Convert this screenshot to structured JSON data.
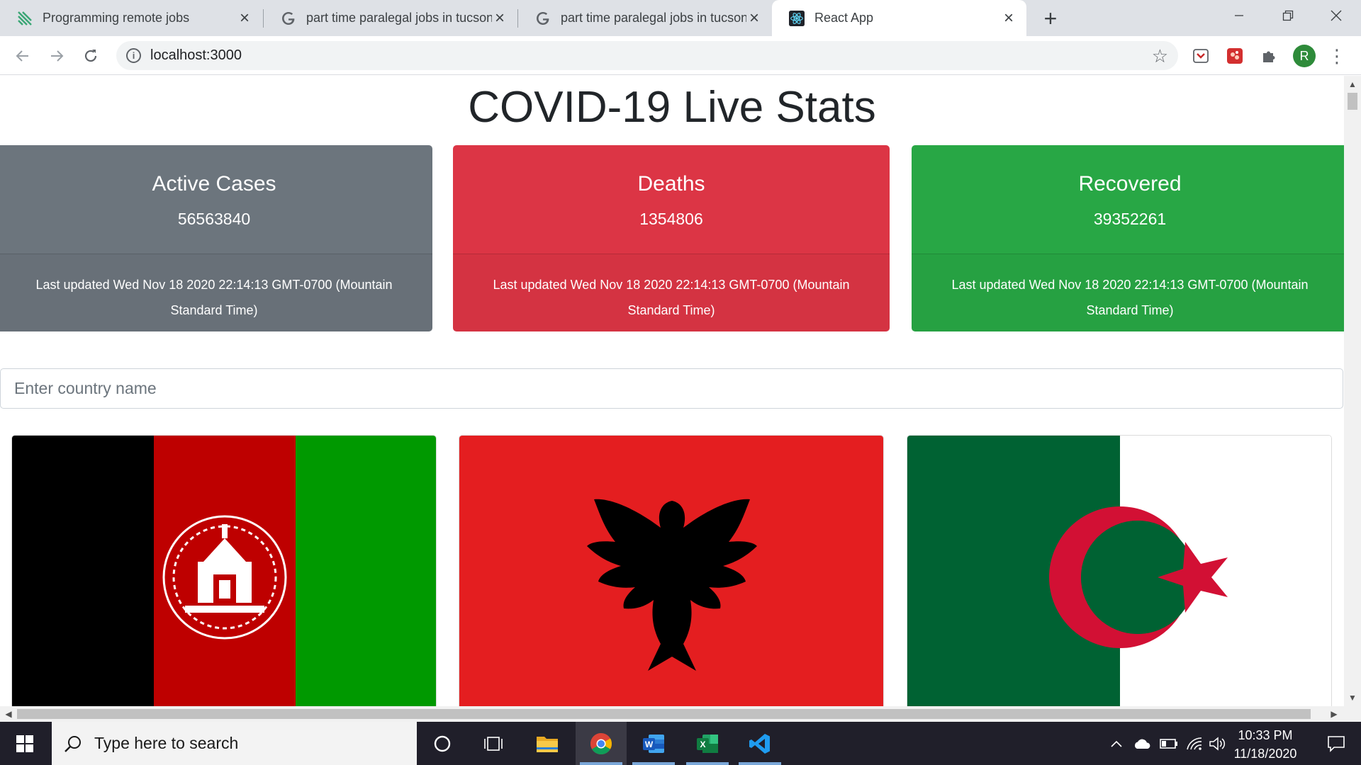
{
  "browser": {
    "tabs": [
      {
        "title": "Programming remote jobs",
        "favicon": "remote-jobs-icon"
      },
      {
        "title": "part time paralegal jobs in tucson",
        "favicon": "google-icon"
      },
      {
        "title": "part time paralegal jobs in tucson",
        "favicon": "google-icon"
      },
      {
        "title": "React App",
        "favicon": "react-icon"
      }
    ],
    "active_tab_index": 3,
    "address": "localhost:3000",
    "profile_initial": "R"
  },
  "page": {
    "title": "COVID-19 Live Stats",
    "cards": [
      {
        "label": "Active Cases",
        "value": "56563840",
        "updated": "Last updated Wed Nov 18 2020 22:14:13 GMT-0700 (Mountain Standard Time)",
        "color": "#6c757d"
      },
      {
        "label": "Deaths",
        "value": "1354806",
        "updated": "Last updated Wed Nov 18 2020 22:14:13 GMT-0700 (Mountain Standard Time)",
        "color": "#dc3545"
      },
      {
        "label": "Recovered",
        "value": "39352261",
        "updated": "Last updated Wed Nov 18 2020 22:14:13 GMT-0700 (Mountain Standard Time)",
        "color": "#28a745"
      }
    ],
    "search": {
      "placeholder": "Enter country name",
      "value": ""
    },
    "flags": [
      "afghanistan-flag",
      "albania-flag",
      "algeria-flag"
    ]
  },
  "taskbar": {
    "search_placeholder": "Type here to search",
    "time": "10:33 PM",
    "date": "11/18/2020",
    "apps": [
      "cortana-icon",
      "task-view-icon",
      "file-explorer-icon",
      "chrome-icon",
      "word-icon",
      "excel-icon",
      "vscode-icon"
    ]
  }
}
